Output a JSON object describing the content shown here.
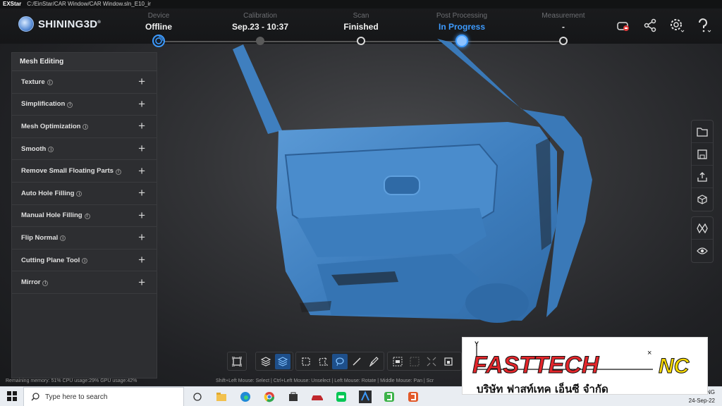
{
  "titlebar": {
    "app": "EXStar",
    "path": "C:/EinStar/CAR Window/CAR Window.sln_E10_ir"
  },
  "logo": {
    "text": "SHINING3D",
    "mark": "®"
  },
  "steps": [
    {
      "label": "Device",
      "value": "Offline",
      "state": "done-ring"
    },
    {
      "label": "Calibration",
      "value": "Sep.23 - 10:37",
      "state": "dim"
    },
    {
      "label": "Scan",
      "value": "Finished",
      "state": "done"
    },
    {
      "label": "Post Processing",
      "value": "In Progress",
      "state": "active"
    },
    {
      "label": "Measurement",
      "value": "-",
      "state": "pending"
    }
  ],
  "header_icons": [
    "dongle-icon",
    "share-icon",
    "settings-icon",
    "help-icon"
  ],
  "panel": {
    "title": "Mesh Editing",
    "items": [
      {
        "label": "Texture"
      },
      {
        "label": "Simplification"
      },
      {
        "label": "Mesh Optimization"
      },
      {
        "label": "Smooth"
      },
      {
        "label": "Remove Small Floating Parts"
      },
      {
        "label": "Auto Hole Filling"
      },
      {
        "label": "Manual Hole Filling"
      },
      {
        "label": "Flip Normal"
      },
      {
        "label": "Cutting Plane Tool"
      },
      {
        "label": "Mirror"
      }
    ],
    "info_glyph": "i",
    "plus_glyph": "+"
  },
  "right_toolbar": {
    "group1": [
      "open-folder-icon",
      "save-icon",
      "export-icon",
      "view-cube-icon"
    ],
    "group2": [
      "mesh-icon",
      "visibility-eye-icon"
    ]
  },
  "bottom_toolbar": {
    "group1": [
      "fit-view-icon"
    ],
    "group2": [
      "layers-icon",
      "selected-layer-icon"
    ],
    "group3": [
      "rect-select-icon",
      "polygon-select-icon",
      "lasso-select-icon",
      "line-select-icon",
      "brush-select-icon"
    ],
    "group4": [
      "select-all-icon",
      "invert-select-icon",
      "expand-select-icon",
      "delete-select-icon"
    ]
  },
  "status": {
    "memory": "Remaining memory: 51%  CPU usage:29%  GPU usage:42%",
    "hint": "Shift+Left Mouse: Select | Ctrl+Left Mouse: Unselect | Left Mouse: Rotate | Middle Mouse: Pan | Scr"
  },
  "taskbar": {
    "search_placeholder": "Type here to search",
    "apps": [
      "task-view-icon",
      "file-explorer-icon",
      "edge-icon",
      "chrome-icon",
      "store-icon",
      "car-app-icon",
      "line-app-icon",
      "exstar-app-icon",
      "camtasia-icon",
      "camtasia-rec-icon"
    ],
    "tray_lang": "ENG",
    "tray_date": "24-Sep-22"
  },
  "brand": {
    "name": "FASTTECH",
    "suffix": "NC",
    "thai": "บริษัท ฟาสท์เทค เอ็นซี จำกัด",
    "axis_y": "Y",
    "axis_x": "×"
  },
  "colors": {
    "accent": "#3d9bff",
    "mesh": "#4a8ccc",
    "brand_red": "#e3262b",
    "brand_yellow": "#f5d800"
  }
}
